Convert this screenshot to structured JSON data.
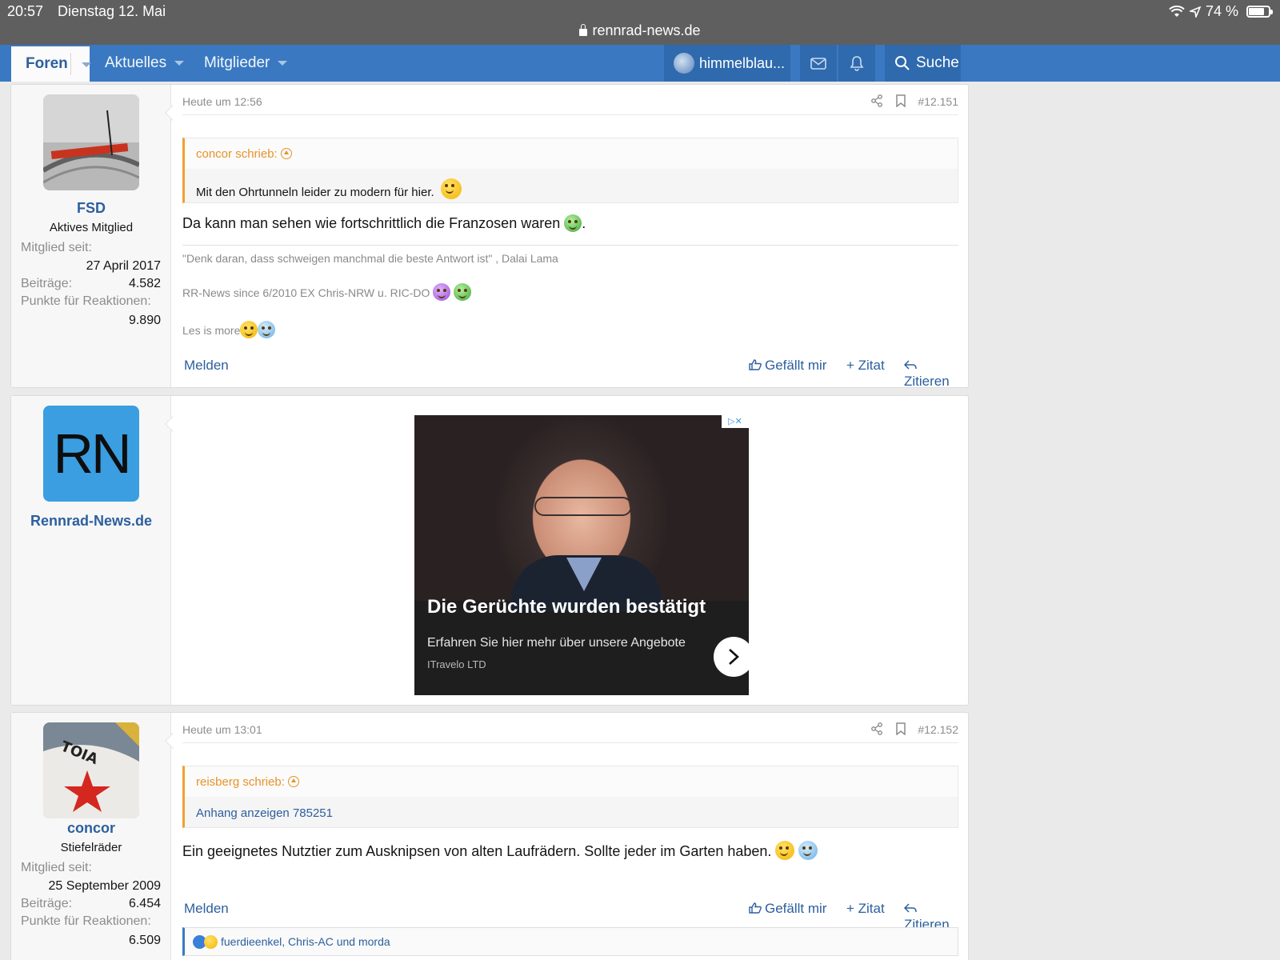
{
  "status": {
    "time": "20:57",
    "date": "Dienstag 12. Mai",
    "battery": "74 %",
    "battery_level": 0.74,
    "url": "rennrad-news.de"
  },
  "nav": {
    "foren": "Foren",
    "aktuelles": "Aktuelles",
    "mitglieder": "Mitglieder",
    "user": "himmelblau...",
    "search": "Suche"
  },
  "posts": [
    {
      "user": {
        "name": "FSD",
        "title": "Aktives Mitglied",
        "member_since_label": "Mitglied seit:",
        "member_since": "27 April 2017",
        "posts_label": "Beiträge:",
        "posts": "4.582",
        "points_label": "Punkte für Reaktionen:",
        "points": "9.890"
      },
      "date": "Heute um 12:56",
      "number": "#12.151",
      "quote": {
        "author": "concor schrieb:",
        "text": "Mit den Ohrtunneln leider zu modern für hier."
      },
      "message": "Da kann man sehen wie fortschrittlich die Franzosen waren",
      "message_end": ".",
      "signature": [
        "\"Denk daran, dass schweigen manchmal die beste Antwort ist\" , Dalai Lama",
        "RR-News since 6/2010 EX Chris-NRW u. RIC-DO",
        "Les is more"
      ],
      "actions": {
        "report": "Melden",
        "like": "Gefällt mir",
        "multiquote": "+ Zitat",
        "quote": "Zitieren"
      }
    },
    {
      "user": {
        "name": "concor",
        "title": "Stiefelräder",
        "member_since_label": "Mitglied seit:",
        "member_since": "25 September 2009",
        "posts_label": "Beiträge:",
        "posts": "6.454",
        "points_label": "Punkte für Reaktionen:",
        "points": "6.509"
      },
      "date": "Heute um 13:01",
      "number": "#12.152",
      "quote": {
        "author": "reisberg schrieb:",
        "text": "Anhang anzeigen 785251"
      },
      "message": "Ein geeignetes Nutztier zum Ausknipsen von alten Laufrädern. Sollte jeder im Garten haben.",
      "actions": {
        "report": "Melden",
        "like": "Gefällt mir",
        "multiquote": "+ Zitat",
        "quote": "Zitieren"
      },
      "reactions": "fuerdieenkel, Chris-AC und morda"
    }
  ],
  "ad": {
    "sponsor_name": "Rennrad-News.de",
    "logo_text": "RN",
    "title": "Die Gerüchte wurden bestätigt",
    "subtitle": "Erfahren Sie hier mehr über unsere Angebote",
    "brand": "ITravelo LTD"
  },
  "colors": {
    "nav_bg": "#3a79c2",
    "link": "#2c5f9e",
    "quote_accent": "#f0a030"
  }
}
